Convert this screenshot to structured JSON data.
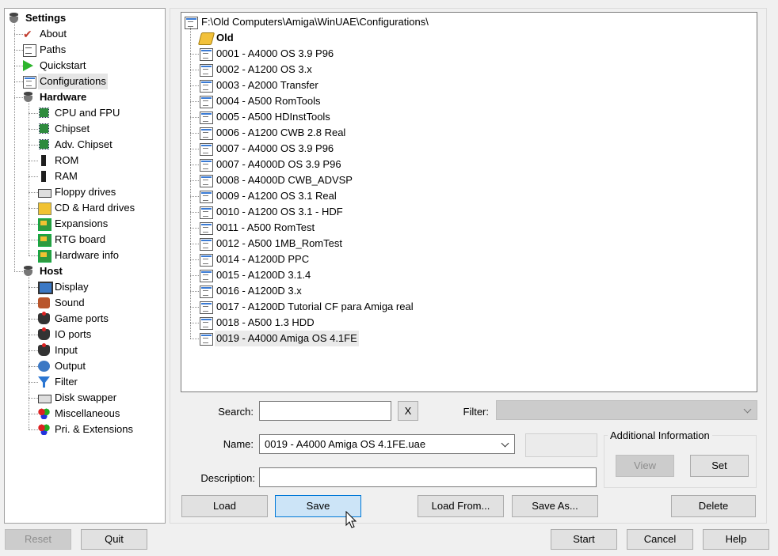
{
  "tree": {
    "items": [
      {
        "label": "Settings",
        "bold": true,
        "icon": "disk-icon"
      },
      {
        "label": "About",
        "icon": "checkmark-icon"
      },
      {
        "label": "Paths",
        "icon": "paths-icon"
      },
      {
        "label": "Quickstart",
        "icon": "play-icon"
      },
      {
        "label": "Configurations",
        "icon": "config-icon",
        "selected": true
      },
      {
        "label": "Hardware",
        "bold": true,
        "icon": "disk-icon"
      },
      {
        "label": "CPU and FPU",
        "icon": "chip-icon"
      },
      {
        "label": "Chipset",
        "icon": "chip-icon"
      },
      {
        "label": "Adv. Chipset",
        "icon": "chip-icon"
      },
      {
        "label": "ROM",
        "icon": "memory-icon"
      },
      {
        "label": "RAM",
        "icon": "memory-icon"
      },
      {
        "label": "Floppy drives",
        "icon": "floppy-drive-icon"
      },
      {
        "label": "CD & Hard drives",
        "icon": "cd-icon"
      },
      {
        "label": "Expansions",
        "icon": "expansion-card-icon"
      },
      {
        "label": "RTG board",
        "icon": "expansion-card-icon"
      },
      {
        "label": "Hardware info",
        "icon": "expansion-card-icon"
      },
      {
        "label": "Host",
        "bold": true,
        "icon": "disk-icon"
      },
      {
        "label": "Display",
        "icon": "monitor-icon"
      },
      {
        "label": "Sound",
        "icon": "speaker-icon"
      },
      {
        "label": "Game ports",
        "icon": "joystick-icon"
      },
      {
        "label": "IO ports",
        "icon": "io-icon"
      },
      {
        "label": "Input",
        "icon": "joystick-icon"
      },
      {
        "label": "Output",
        "icon": "output-icon"
      },
      {
        "label": "Filter",
        "icon": "filter-icon"
      },
      {
        "label": "Disk swapper",
        "icon": "floppy-drive-icon"
      },
      {
        "label": "Miscellaneous",
        "icon": "misc-icon"
      },
      {
        "label": "Pri. & Extensions",
        "icon": "misc-icon"
      }
    ]
  },
  "configs": {
    "root": "F:\\Old Computers\\Amiga\\WinUAE\\Configurations\\",
    "folder": "Old",
    "items": [
      "0001 - A4000 OS 3.9 P96",
      "0002 - A1200 OS 3.x",
      "0003 - A2000 Transfer",
      "0004 - A500 RomTools",
      "0005 - A500 HDInstTools",
      "0006 - A1200 CWB 2.8 Real",
      "0007 - A4000 OS 3.9 P96",
      "0007 - A4000D OS 3.9 P96",
      "0008 - A4000D CWB_ADVSP",
      "0009 - A1200 OS 3.1 Real",
      "0010 - A1200 OS 3.1 - HDF",
      "0011 - A500 RomTest",
      "0012 - A500 1MB_RomTest",
      "0014 - A1200D PPC",
      "0015 - A1200D 3.1.4",
      "0016 - A1200D 3.x",
      "0017 - A1200D Tutorial CF para Amiga real",
      "0018 - A500 1.3 HDD",
      "0019 - A4000 Amiga OS 4.1FE"
    ],
    "selected_index": 18
  },
  "form": {
    "search_label": "Search:",
    "search_value": "",
    "clear_label": "X",
    "filter_label": "Filter:",
    "filter_value": "",
    "name_label": "Name:",
    "name_value": "0019 - A4000 Amiga OS 4.1FE.uae",
    "description_label": "Description:",
    "description_value": "",
    "additional_info_label": "Additional Information",
    "view_label": "View",
    "set_label": "Set"
  },
  "actions": {
    "load": "Load",
    "save": "Save",
    "load_from": "Load From...",
    "save_as": "Save As...",
    "delete": "Delete"
  },
  "bottom": {
    "reset": "Reset",
    "quit": "Quit",
    "start": "Start",
    "cancel": "Cancel",
    "help": "Help"
  }
}
